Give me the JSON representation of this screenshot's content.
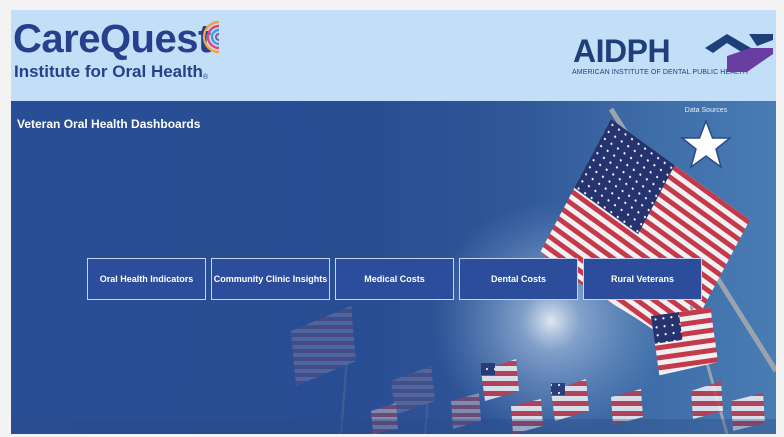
{
  "header": {
    "left_logo": {
      "name": "CareQuest",
      "subtitle": "Institute for Oral Health",
      "registered_mark": "®",
      "color": "#27408b"
    },
    "right_logo": {
      "name": "AIDPH",
      "subtitle": "AMERICAN INSTITUTE OF DENTAL PUBLIC HEALTH",
      "color": "#1f3f7a",
      "mark_colors": [
        "#1f3f7a",
        "#6a3ea0"
      ]
    },
    "background": "#c3dff7"
  },
  "hero": {
    "title": "Veteran Oral Health Dashboards",
    "data_sources": {
      "label": "Data Sources",
      "icon": "star-icon"
    },
    "background_image": "american-flags-photo"
  },
  "nav": {
    "buttons": [
      {
        "label": "Oral Health Indicators"
      },
      {
        "label": "Community Clinic Insights"
      },
      {
        "label": "Medical Costs"
      },
      {
        "label": "Dental Costs"
      },
      {
        "label": "Rural Veterans"
      }
    ]
  }
}
